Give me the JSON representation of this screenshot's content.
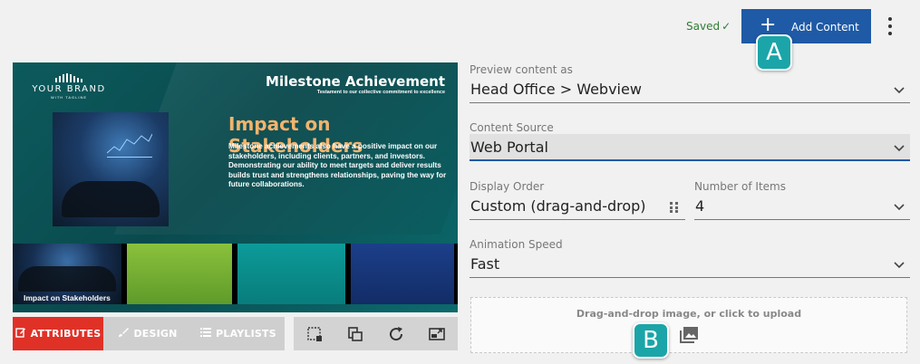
{
  "header": {
    "saved_label": "Saved",
    "add_content_label": "Add Content"
  },
  "badges": {
    "a": "A",
    "b": "B"
  },
  "preview": {
    "logo_brand": "YOUR BRAND",
    "logo_tagline": "WITH TAGLINE",
    "title": "Milestone Achievement",
    "subtitle": "Testament to our collective commitment to excellence",
    "heading": "Impact on Stakeholders",
    "body": "Milestone achievements also have a positive impact on our stakeholders, including clients, partners, and investors. Demonstrating our ability to meet targets and deliver results builds trust and strengthens relationships, paving the way for future collaborations.",
    "thumb_caption": "Impact on Stakeholders"
  },
  "tabs": {
    "attributes": "ATTRIBUTES",
    "design": "DESIGN",
    "playlists": "PLAYLISTS"
  },
  "form": {
    "preview_as": {
      "label": "Preview content as",
      "value": "Head Office > Webview"
    },
    "content_source": {
      "label": "Content Source",
      "value": "Web Portal"
    },
    "display_order": {
      "label": "Display Order",
      "value": "Custom (drag-and-drop)"
    },
    "number_of_items": {
      "label": "Number of Items",
      "value": "4"
    },
    "animation_speed": {
      "label": "Animation Speed",
      "value": "Fast"
    },
    "dropzone_text": "Drag-and-drop image, or click to upload"
  },
  "colors": {
    "primary": "#1f5aa6",
    "active_tab": "#e03127",
    "badge": "#1ba5a8",
    "saved": "#2e7d32"
  }
}
